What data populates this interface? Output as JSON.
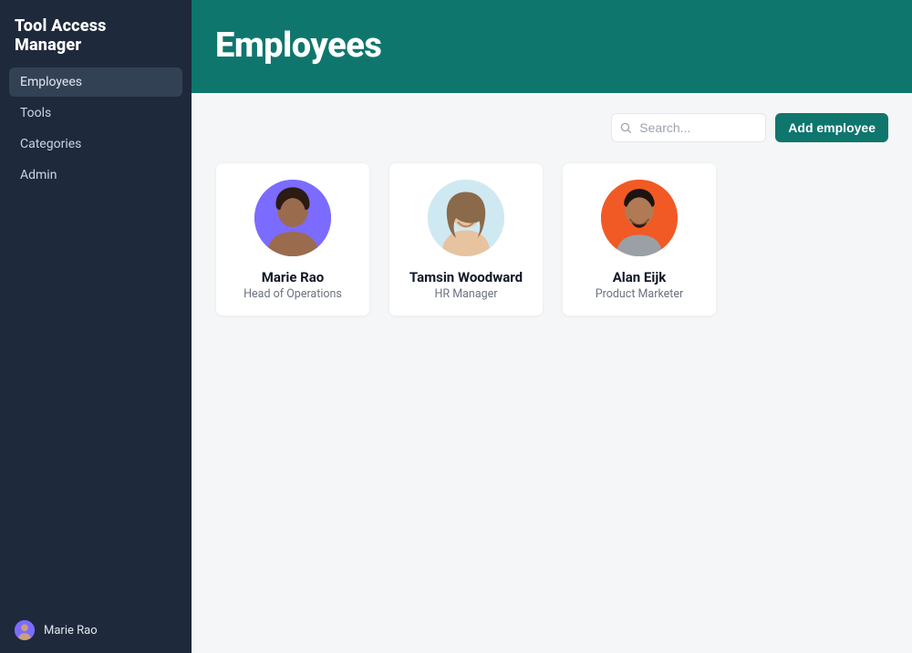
{
  "app": {
    "title": "Tool Access Manager"
  },
  "sidebar": {
    "items": [
      {
        "label": "Employees",
        "active": true
      },
      {
        "label": "Tools",
        "active": false
      },
      {
        "label": "Categories",
        "active": false
      },
      {
        "label": "Admin",
        "active": false
      }
    ]
  },
  "header": {
    "title": "Employees"
  },
  "toolbar": {
    "search_placeholder": "Search...",
    "add_label": "Add employee"
  },
  "employees": [
    {
      "name": "Marie Rao",
      "role": "Head of Operations",
      "avatar_bg": "#7c6bff"
    },
    {
      "name": "Tamsin Woodward",
      "role": "HR Manager",
      "avatar_bg": "#cfe9f2"
    },
    {
      "name": "Alan Eijk",
      "role": "Product Marketer",
      "avatar_bg": "#f15a24"
    }
  ],
  "footer": {
    "user_name": "Marie Rao",
    "avatar_bg": "#7c6bff"
  }
}
